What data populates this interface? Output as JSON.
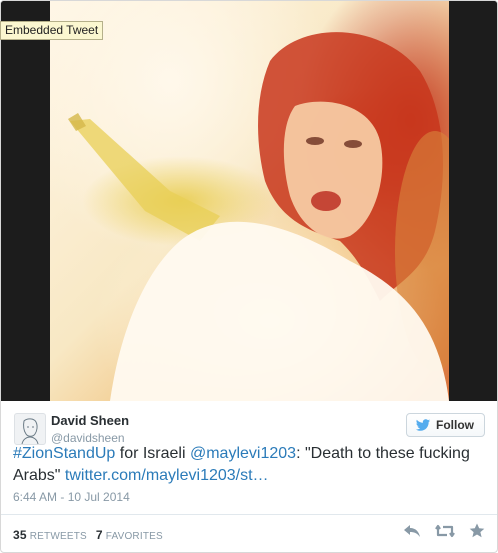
{
  "tooltip": {
    "text": "Embedded Tweet"
  },
  "author": {
    "name": "David Sheen",
    "handle": "@davidsheen",
    "follow_label": "Follow"
  },
  "tweet": {
    "hashtag": "#ZionStandUp",
    "text_1": " for Israeli ",
    "mention": "@maylevi1203",
    "text_2": ": \"Death to these fucking Arabs\" ",
    "url": "twitter.com/maylevi1203/st…"
  },
  "timestamp": "6:44 AM - 10 Jul 2014",
  "stats": {
    "retweets_count": "35",
    "retweets_label": "RETWEETS",
    "favorites_count": "7",
    "favorites_label": "FAVORITES"
  },
  "icons": {
    "follow": "twitter-bird-icon",
    "reply": "reply-icon",
    "retweet": "retweet-icon",
    "favorite": "star-icon"
  },
  "colors": {
    "link": "#2b7bb9",
    "muted": "#8899a6",
    "text": "#292f33"
  }
}
